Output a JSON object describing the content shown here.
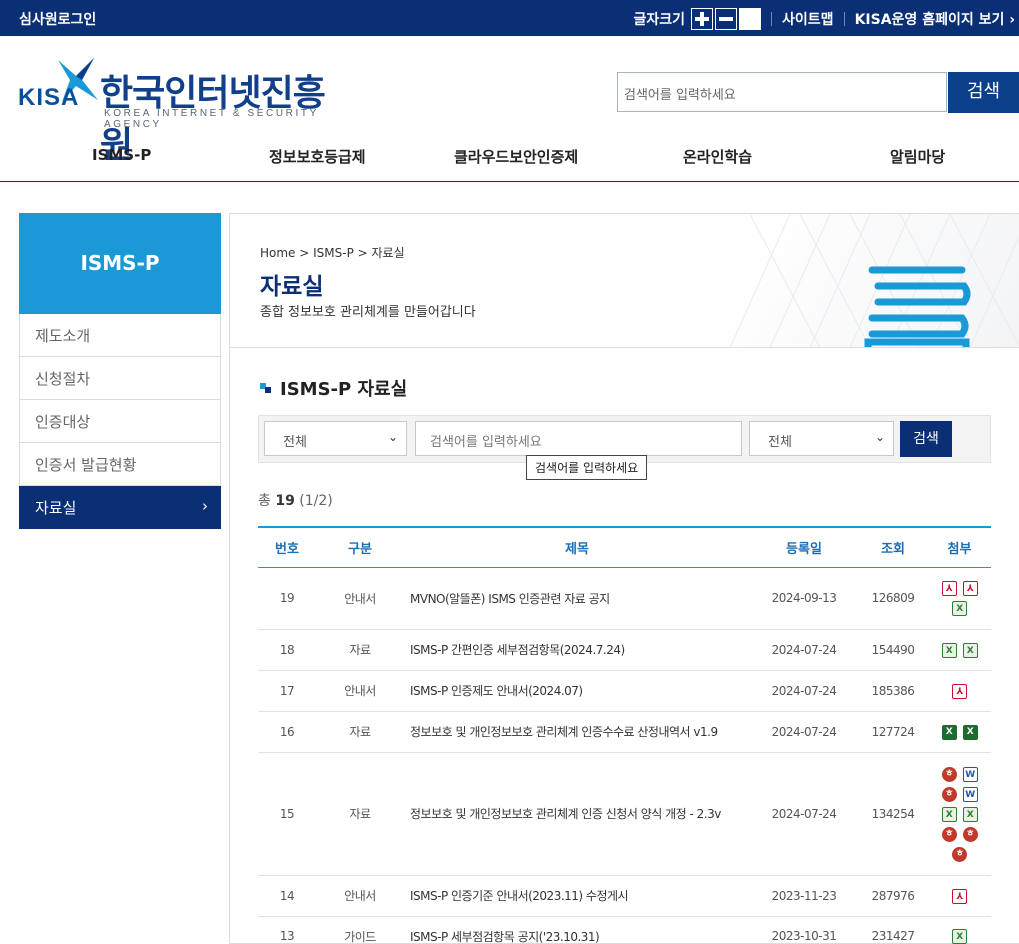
{
  "topbar": {
    "login": "심사원로그인",
    "font_size_label": "글자크기",
    "sitemap": "사이트맵",
    "kisa_home": "KISA운영 홈페이지 보기 ›"
  },
  "header": {
    "logo_kisa": "KISA",
    "logo_name": "한국인터넷진흥원",
    "logo_sub": "KOREA INTERNET & SECURITY AGENCY",
    "search_placeholder": "검색어를 입력하세요",
    "search_button": "검색"
  },
  "gnb": [
    "ISMS-P",
    "정보보호등급제",
    "클라우드보안인증제",
    "온라인학습",
    "알림마당"
  ],
  "lnb": {
    "title": "ISMS-P",
    "items": [
      "제도소개",
      "신청절차",
      "인증대상",
      "인증서 발급현황",
      "자료실"
    ],
    "active_arrow": "›"
  },
  "content": {
    "breadcrumb": "Home > ISMS-P > 자료실",
    "title": "자료실",
    "desc": "종합 정보보호 관리체계를 만들어갑니다",
    "section_title": "ISMS-P 자료실",
    "filter": {
      "category": "전체",
      "input_placeholder": "검색어를 입력하세요",
      "field": "전체",
      "button": "검색",
      "tooltip": "검색어를 입력하세요"
    },
    "total_prefix": "총",
    "total_count": "19",
    "total_page": "(1/2)"
  },
  "table": {
    "headers": [
      "번호",
      "구분",
      "제목",
      "등록일",
      "조회",
      "첨부"
    ],
    "rows": [
      {
        "no": "19",
        "type": "안내서",
        "title": "MVNO(알뜰폰) ISMS 인증관련 자료 공지",
        "date": "2024-09-13",
        "views": "126809",
        "files": [
          "pdf",
          "pdf",
          "xls"
        ]
      },
      {
        "no": "18",
        "type": "자료",
        "title": "ISMS-P 간편인증 세부점검항목(2024.7.24)",
        "date": "2024-07-24",
        "views": "154490",
        "files": [
          "xls",
          "xls"
        ]
      },
      {
        "no": "17",
        "type": "안내서",
        "title": "ISMS-P 인증제도 안내서(2024.07)",
        "date": "2024-07-24",
        "views": "185386",
        "files": [
          "pdf"
        ]
      },
      {
        "no": "16",
        "type": "자료",
        "title": "정보보호 및 개인정보보호 관리체계 인증수수료 산정내역서 v1.9",
        "date": "2024-07-24",
        "views": "127724",
        "files": [
          "xlsx",
          "xlsx"
        ]
      },
      {
        "no": "15",
        "type": "자료",
        "title": "정보보호 및 개인정보보호 관리체계 인증 신청서 양식 개정 - 2.3v",
        "date": "2024-07-24",
        "views": "134254",
        "files": [
          "hwp",
          "doc",
          "hwp",
          "doc",
          "xls",
          "xls",
          "hwp",
          "hwp",
          "hwp"
        ]
      },
      {
        "no": "14",
        "type": "안내서",
        "title": "ISMS-P 인증기준 안내서(2023.11) 수정게시",
        "date": "2023-11-23",
        "views": "287976",
        "files": [
          "pdf"
        ]
      },
      {
        "no": "13",
        "type": "가이드",
        "title": "ISMS-P 세부점검항목 공지('23.10.31)",
        "date": "2023-10-31",
        "views": "231427",
        "files": [
          "xls"
        ]
      }
    ]
  },
  "icons": {
    "pdf": "pdf-icon",
    "xls": "excel-icon",
    "xlsx": "excel-icon",
    "hwp": "hwp-icon",
    "doc": "word-icon"
  },
  "colors": {
    "navy": "#0a2f74",
    "sky": "#1a99d6"
  }
}
